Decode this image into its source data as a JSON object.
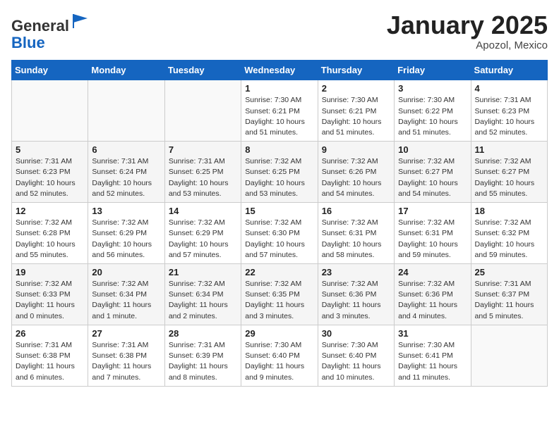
{
  "header": {
    "logo_line1": "General",
    "logo_line2": "Blue",
    "month": "January 2025",
    "location": "Apozol, Mexico"
  },
  "weekdays": [
    "Sunday",
    "Monday",
    "Tuesday",
    "Wednesday",
    "Thursday",
    "Friday",
    "Saturday"
  ],
  "weeks": [
    [
      {
        "day": "",
        "info": ""
      },
      {
        "day": "",
        "info": ""
      },
      {
        "day": "",
        "info": ""
      },
      {
        "day": "1",
        "info": "Sunrise: 7:30 AM\nSunset: 6:21 PM\nDaylight: 10 hours\nand 51 minutes."
      },
      {
        "day": "2",
        "info": "Sunrise: 7:30 AM\nSunset: 6:21 PM\nDaylight: 10 hours\nand 51 minutes."
      },
      {
        "day": "3",
        "info": "Sunrise: 7:30 AM\nSunset: 6:22 PM\nDaylight: 10 hours\nand 51 minutes."
      },
      {
        "day": "4",
        "info": "Sunrise: 7:31 AM\nSunset: 6:23 PM\nDaylight: 10 hours\nand 52 minutes."
      }
    ],
    [
      {
        "day": "5",
        "info": "Sunrise: 7:31 AM\nSunset: 6:23 PM\nDaylight: 10 hours\nand 52 minutes."
      },
      {
        "day": "6",
        "info": "Sunrise: 7:31 AM\nSunset: 6:24 PM\nDaylight: 10 hours\nand 52 minutes."
      },
      {
        "day": "7",
        "info": "Sunrise: 7:31 AM\nSunset: 6:25 PM\nDaylight: 10 hours\nand 53 minutes."
      },
      {
        "day": "8",
        "info": "Sunrise: 7:32 AM\nSunset: 6:25 PM\nDaylight: 10 hours\nand 53 minutes."
      },
      {
        "day": "9",
        "info": "Sunrise: 7:32 AM\nSunset: 6:26 PM\nDaylight: 10 hours\nand 54 minutes."
      },
      {
        "day": "10",
        "info": "Sunrise: 7:32 AM\nSunset: 6:27 PM\nDaylight: 10 hours\nand 54 minutes."
      },
      {
        "day": "11",
        "info": "Sunrise: 7:32 AM\nSunset: 6:27 PM\nDaylight: 10 hours\nand 55 minutes."
      }
    ],
    [
      {
        "day": "12",
        "info": "Sunrise: 7:32 AM\nSunset: 6:28 PM\nDaylight: 10 hours\nand 55 minutes."
      },
      {
        "day": "13",
        "info": "Sunrise: 7:32 AM\nSunset: 6:29 PM\nDaylight: 10 hours\nand 56 minutes."
      },
      {
        "day": "14",
        "info": "Sunrise: 7:32 AM\nSunset: 6:29 PM\nDaylight: 10 hours\nand 57 minutes."
      },
      {
        "day": "15",
        "info": "Sunrise: 7:32 AM\nSunset: 6:30 PM\nDaylight: 10 hours\nand 57 minutes."
      },
      {
        "day": "16",
        "info": "Sunrise: 7:32 AM\nSunset: 6:31 PM\nDaylight: 10 hours\nand 58 minutes."
      },
      {
        "day": "17",
        "info": "Sunrise: 7:32 AM\nSunset: 6:31 PM\nDaylight: 10 hours\nand 59 minutes."
      },
      {
        "day": "18",
        "info": "Sunrise: 7:32 AM\nSunset: 6:32 PM\nDaylight: 10 hours\nand 59 minutes."
      }
    ],
    [
      {
        "day": "19",
        "info": "Sunrise: 7:32 AM\nSunset: 6:33 PM\nDaylight: 11 hours\nand 0 minutes."
      },
      {
        "day": "20",
        "info": "Sunrise: 7:32 AM\nSunset: 6:34 PM\nDaylight: 11 hours\nand 1 minute."
      },
      {
        "day": "21",
        "info": "Sunrise: 7:32 AM\nSunset: 6:34 PM\nDaylight: 11 hours\nand 2 minutes."
      },
      {
        "day": "22",
        "info": "Sunrise: 7:32 AM\nSunset: 6:35 PM\nDaylight: 11 hours\nand 3 minutes."
      },
      {
        "day": "23",
        "info": "Sunrise: 7:32 AM\nSunset: 6:36 PM\nDaylight: 11 hours\nand 3 minutes."
      },
      {
        "day": "24",
        "info": "Sunrise: 7:32 AM\nSunset: 6:36 PM\nDaylight: 11 hours\nand 4 minutes."
      },
      {
        "day": "25",
        "info": "Sunrise: 7:31 AM\nSunset: 6:37 PM\nDaylight: 11 hours\nand 5 minutes."
      }
    ],
    [
      {
        "day": "26",
        "info": "Sunrise: 7:31 AM\nSunset: 6:38 PM\nDaylight: 11 hours\nand 6 minutes."
      },
      {
        "day": "27",
        "info": "Sunrise: 7:31 AM\nSunset: 6:38 PM\nDaylight: 11 hours\nand 7 minutes."
      },
      {
        "day": "28",
        "info": "Sunrise: 7:31 AM\nSunset: 6:39 PM\nDaylight: 11 hours\nand 8 minutes."
      },
      {
        "day": "29",
        "info": "Sunrise: 7:30 AM\nSunset: 6:40 PM\nDaylight: 11 hours\nand 9 minutes."
      },
      {
        "day": "30",
        "info": "Sunrise: 7:30 AM\nSunset: 6:40 PM\nDaylight: 11 hours\nand 10 minutes."
      },
      {
        "day": "31",
        "info": "Sunrise: 7:30 AM\nSunset: 6:41 PM\nDaylight: 11 hours\nand 11 minutes."
      },
      {
        "day": "",
        "info": ""
      }
    ]
  ]
}
